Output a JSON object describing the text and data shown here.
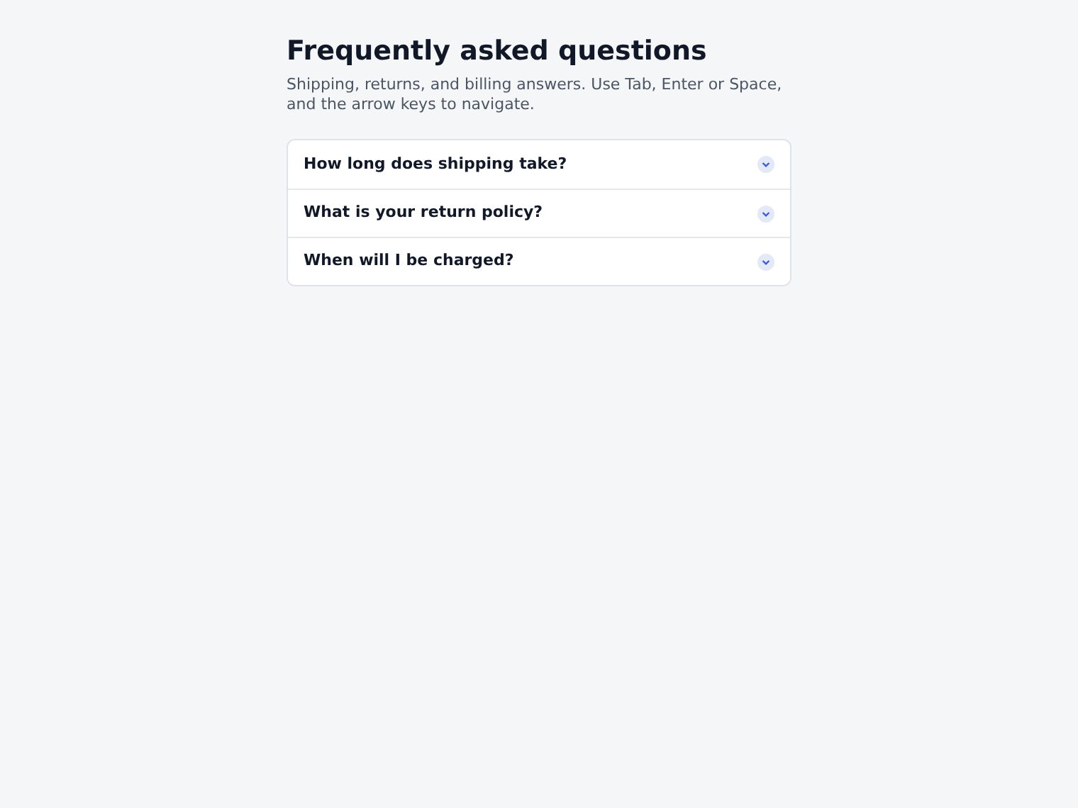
{
  "title": "Frequently asked questions",
  "subtitle": "Shipping, returns, and billing answers. Use Tab, Enter or Space, and the arrow keys to navigate.",
  "items": [
    {
      "question": "How long does shipping take?",
      "expanded": false
    },
    {
      "question": "What is your return policy?",
      "expanded": false
    },
    {
      "question": "When will I be charged?",
      "expanded": false
    }
  ]
}
